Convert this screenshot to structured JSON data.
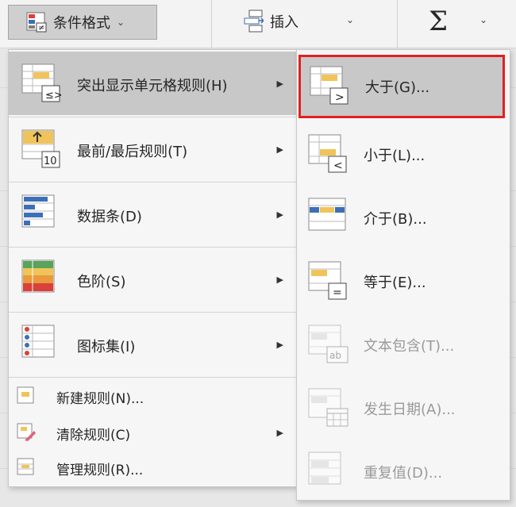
{
  "ribbon": {
    "conditional_format": "条件格式",
    "insert": "插入",
    "sum_symbol": "Σ",
    "chevron": "⌄"
  },
  "menu": {
    "items": [
      {
        "label": "突出显示单元格规则(H)",
        "icon": "highlight-cells-rules-icon",
        "has_submenu": true,
        "selected": true
      },
      {
        "label": "最前/最后规则(T)",
        "icon": "top-bottom-rules-icon",
        "has_submenu": true
      },
      {
        "label": "数据条(D)",
        "icon": "data-bars-icon",
        "has_submenu": true
      },
      {
        "label": "色阶(S)",
        "icon": "color-scales-icon",
        "has_submenu": true
      },
      {
        "label": "图标集(I)",
        "icon": "icon-sets-icon",
        "has_submenu": true
      }
    ],
    "small_items": [
      {
        "label": "新建规则(N)...",
        "icon": "new-rule-icon"
      },
      {
        "label": "清除规则(C)",
        "icon": "clear-rules-icon",
        "has_submenu": true
      },
      {
        "label": "管理规则(R)...",
        "icon": "manage-rules-icon"
      }
    ],
    "submenu_arrow": "▶"
  },
  "submenu": {
    "items": [
      {
        "label": "大于(G)...",
        "icon": "greater-than-icon",
        "highlighted": true
      },
      {
        "label": "小于(L)...",
        "icon": "less-than-icon"
      },
      {
        "label": "介于(B)...",
        "icon": "between-icon"
      },
      {
        "label": "等于(E)...",
        "icon": "equal-to-icon"
      },
      {
        "label": "文本包含(T)...",
        "icon": "text-contains-icon",
        "disabled": true
      },
      {
        "label": "发生日期(A)...",
        "icon": "date-occurring-icon",
        "disabled": true
      },
      {
        "label": "重复值(D)...",
        "icon": "duplicate-values-icon",
        "disabled": true
      }
    ]
  },
  "colors": {
    "accent_yellow": "#f0c45a",
    "highlight_red": "#e02020",
    "selected_bg": "#c8c8c8"
  }
}
